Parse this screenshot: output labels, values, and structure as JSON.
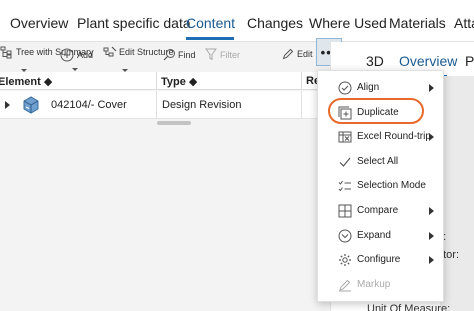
{
  "tabs": [
    "Overview",
    "Plant specific data",
    "Content",
    "Changes",
    "Where Used",
    "Materials",
    "Atta"
  ],
  "active_tab": "Content",
  "toolbar": {
    "tree_summary": "Tree with Summary",
    "add": "Add",
    "edit_structure": "Edit Structure",
    "find": "Find",
    "filter": "Filter",
    "edit": "Edit",
    "more": "•••"
  },
  "grid": {
    "columns": [
      "Element",
      "Type",
      "Re"
    ],
    "rows": [
      {
        "element": "042104/- Cover",
        "type": "Design Revision"
      }
    ]
  },
  "right_panel": {
    "tabs": [
      "3D",
      "Overview",
      "Pl"
    ],
    "active_tab": "Overview",
    "props": [
      "e:",
      "ator:",
      "Unit Of Measure:"
    ]
  },
  "menu": {
    "items": [
      {
        "label": "Align",
        "icon": "align-check-icon",
        "submenu": true,
        "disabled": false
      },
      {
        "label": "Duplicate",
        "icon": "duplicate-icon",
        "submenu": false,
        "disabled": false
      },
      {
        "label": "Excel Round-trip",
        "icon": "excel-icon",
        "submenu": true,
        "disabled": false
      },
      {
        "label": "Select All",
        "icon": "checkmark-icon",
        "submenu": false,
        "disabled": false
      },
      {
        "label": "Selection Mode",
        "icon": "selection-mode-icon",
        "submenu": false,
        "disabled": false
      },
      {
        "label": "Compare",
        "icon": "compare-icon",
        "submenu": true,
        "disabled": false
      },
      {
        "label": "Expand",
        "icon": "expand-icon",
        "submenu": true,
        "disabled": false
      },
      {
        "label": "Configure",
        "icon": "configure-icon",
        "submenu": true,
        "disabled": false
      },
      {
        "label": "Markup",
        "icon": "markup-icon",
        "submenu": false,
        "disabled": true
      }
    ]
  },
  "colors": {
    "accent": "#1f6fb5",
    "highlight_circle": "#e8692c"
  }
}
